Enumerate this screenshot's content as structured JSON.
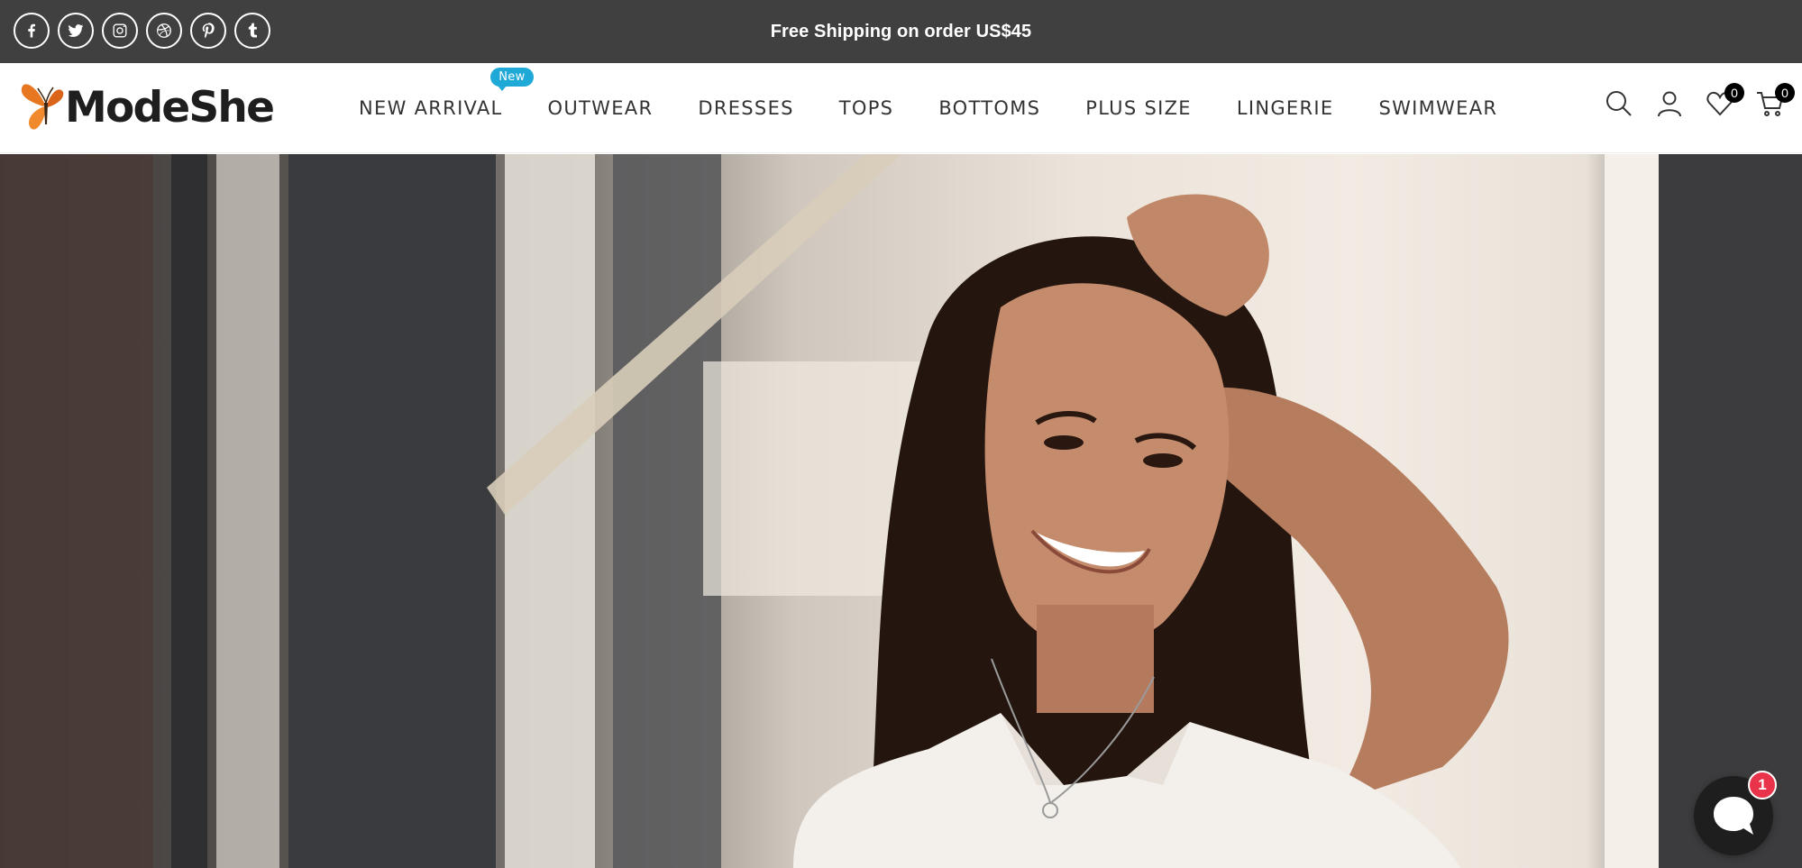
{
  "topbar": {
    "announcement": "Free Shipping on order US$45",
    "socials": [
      "facebook-icon",
      "twitter-icon",
      "instagram-icon",
      "dribbble-icon",
      "pinterest-icon",
      "tumblr-icon"
    ]
  },
  "header": {
    "brand": "ModeShe",
    "nav": [
      {
        "label": "NEW ARRIVAL",
        "badge": "New"
      },
      {
        "label": "OUTWEAR"
      },
      {
        "label": "DRESSES"
      },
      {
        "label": "TOPS"
      },
      {
        "label": "BOTTOMS"
      },
      {
        "label": "PLUS SIZE"
      },
      {
        "label": "LINGERIE"
      },
      {
        "label": "SWIMWEAR"
      }
    ],
    "wishlist_count": "0",
    "cart_count": "0"
  },
  "chat": {
    "unread": "1"
  },
  "colors": {
    "topbar_bg": "#404040",
    "badge": "#1ea9d6",
    "chat_badge": "#e8334a",
    "brand_orange": "#e87722"
  }
}
